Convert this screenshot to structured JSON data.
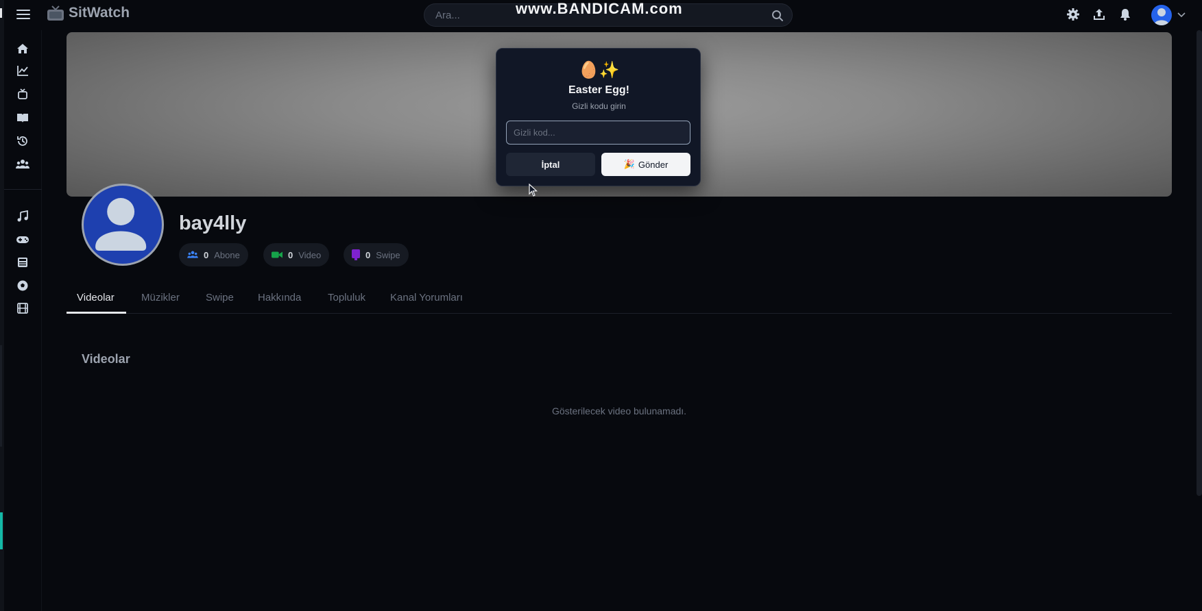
{
  "app": {
    "name": "SitWatch",
    "watermark": "www.BANDICAM.com"
  },
  "header": {
    "search_placeholder": "Ara...",
    "icons": [
      "menu-icon",
      "search-icon",
      "settings-icon",
      "upload-icon",
      "bell-icon",
      "user-avatar-icon",
      "chevron-down-icon"
    ]
  },
  "sidebar": {
    "items": [
      "home-icon",
      "trending-icon",
      "subscriptions-icon",
      "library-icon",
      "history-icon",
      "community-icon",
      "music-icon",
      "gaming-icon",
      "news-icon",
      "sports-icon",
      "film-icon"
    ]
  },
  "profile": {
    "username": "bay4lly",
    "stats": [
      {
        "value": "0",
        "label": "Abone",
        "color": "#3b82f6"
      },
      {
        "value": "0",
        "label": "Video",
        "color": "#16a34a"
      },
      {
        "value": "0",
        "label": "Swipe",
        "color": "#7e22ce"
      }
    ]
  },
  "tabs": [
    {
      "label": "Videolar",
      "active": true
    },
    {
      "label": "Müzikler",
      "active": false
    },
    {
      "label": "Swipe",
      "active": false
    },
    {
      "label": "Hakkında",
      "active": false
    },
    {
      "label": "Topluluk",
      "active": false
    },
    {
      "label": "Kanal Yorumları",
      "active": false
    }
  ],
  "content": {
    "section_title": "Videolar",
    "empty_message": "Gösterilecek video bulunamadı."
  },
  "modal": {
    "emoji": "🥚✨",
    "title": "Easter Egg!",
    "subtitle": "Gizli kodu girin",
    "input_placeholder": "Gizli kod...",
    "input_value": "",
    "cancel_label": "İptal",
    "send_emoji": "🎉",
    "send_label": "Gönder"
  }
}
